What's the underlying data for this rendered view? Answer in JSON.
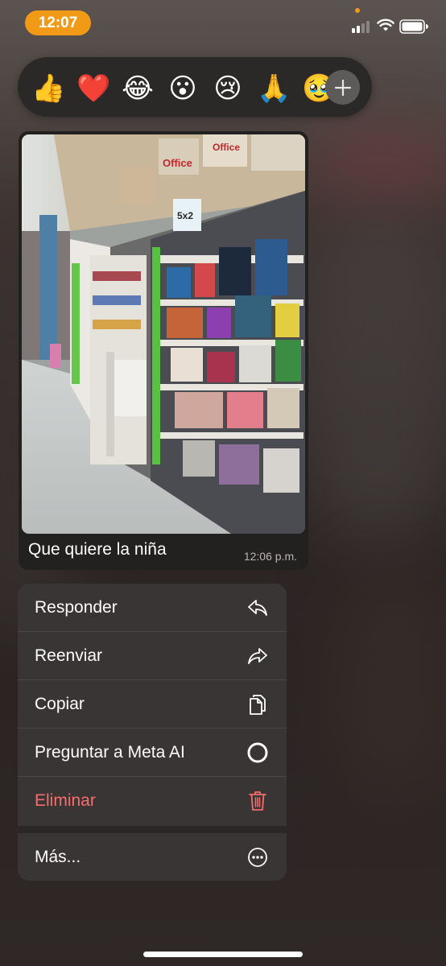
{
  "status_bar": {
    "time": "12:07",
    "accent_color": "#f09a17"
  },
  "reactions": {
    "emojis": [
      {
        "icon": "thumbs-up",
        "glyph": "👍"
      },
      {
        "icon": "red-heart",
        "glyph": "❤️"
      },
      {
        "icon": "face-with-tears-of-joy",
        "glyph": "😂"
      },
      {
        "icon": "face-with-open-mouth",
        "glyph": "😮"
      },
      {
        "icon": "crying-face",
        "glyph": "😢"
      },
      {
        "icon": "folded-hands",
        "glyph": "🙏"
      },
      {
        "icon": "pleading-face",
        "glyph": "🥹"
      }
    ],
    "add_icon": "plus-icon"
  },
  "message": {
    "caption": "Que quiere la niña",
    "time": "12:06 p.m.",
    "photo_description_icon": "store-aisle-photo"
  },
  "menu": {
    "items": [
      {
        "label": "Responder",
        "icon": "reply-icon"
      },
      {
        "label": "Reenviar",
        "icon": "forward-icon"
      },
      {
        "label": "Copiar",
        "icon": "copy-icon"
      },
      {
        "label": "Preguntar a Meta AI",
        "icon": "meta-ai-ring-icon"
      },
      {
        "label": "Eliminar",
        "icon": "trash-icon",
        "color": "#f46e6c"
      }
    ],
    "more": {
      "label": "Más...",
      "icon": "more-icon"
    }
  }
}
